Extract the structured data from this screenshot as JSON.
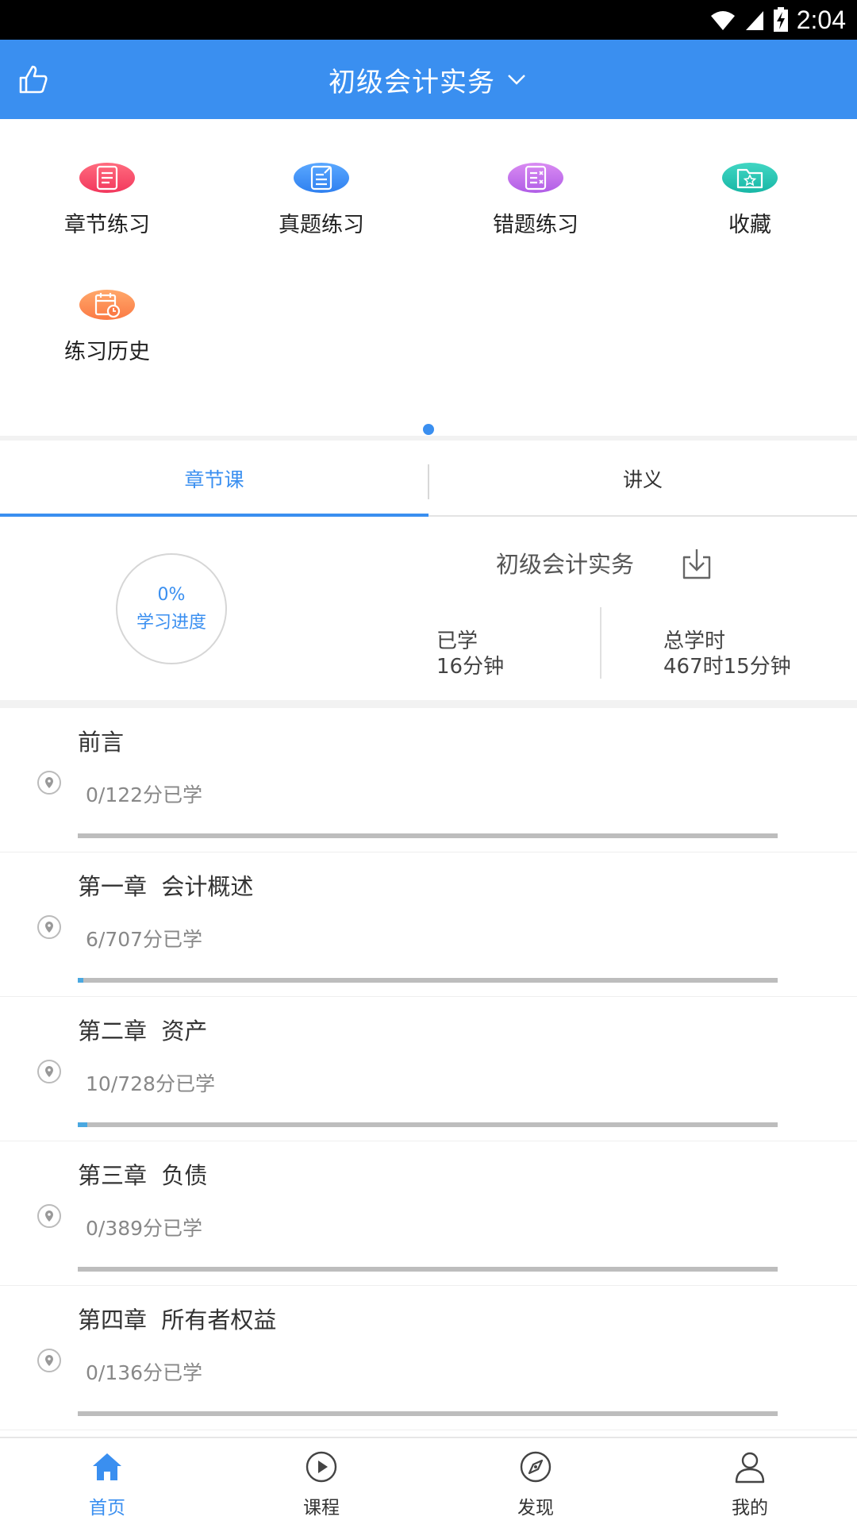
{
  "status_bar": {
    "time": "2:04"
  },
  "app_bar": {
    "title": "初级会计实务"
  },
  "quick_actions": [
    {
      "label": "章节练习",
      "icon": "chapter-practice-icon",
      "color_top": "#ff6b7e",
      "color_bottom": "#f2385d"
    },
    {
      "label": "真题练习",
      "icon": "exam-practice-icon",
      "color_top": "#5aa8ff",
      "color_bottom": "#2f80f0"
    },
    {
      "label": "错题练习",
      "icon": "wrong-question-icon",
      "color_top": "#d98bf2",
      "color_bottom": "#b05de6"
    },
    {
      "label": "收藏",
      "icon": "favorite-folder-icon",
      "color_top": "#41d6c3",
      "color_bottom": "#18b7a6"
    },
    {
      "label": "练习历史",
      "icon": "practice-history-icon",
      "color_top": "#ffa86b",
      "color_bottom": "#fb7a45"
    }
  ],
  "tabs": [
    {
      "label": "章节课",
      "active": true
    },
    {
      "label": "讲义",
      "active": false
    }
  ],
  "summary": {
    "progress_percent": "0%",
    "progress_label": "学习进度",
    "course_title": "初级会计实务",
    "learned_label": "已学",
    "learned_value": "16分钟",
    "total_label": "总学时",
    "total_value": "467时15分钟"
  },
  "chapters": [
    {
      "title": "前言",
      "progress_text": "0/122分已学",
      "fraction": 0.0
    },
    {
      "title": "第一章  会计概述",
      "progress_text": "6/707分已学",
      "fraction": 0.0085
    },
    {
      "title": "第二章  资产",
      "progress_text": "10/728分已学",
      "fraction": 0.0137
    },
    {
      "title": "第三章  负债",
      "progress_text": "0/389分已学",
      "fraction": 0.0
    },
    {
      "title": "第四章  所有者权益",
      "progress_text": "0/136分已学",
      "fraction": 0.0
    }
  ],
  "bottom_nav": [
    {
      "label": "首页",
      "icon": "home-icon",
      "active": true
    },
    {
      "label": "课程",
      "icon": "play-circle-icon",
      "active": false
    },
    {
      "label": "发现",
      "icon": "compass-icon",
      "active": false
    },
    {
      "label": "我的",
      "icon": "person-icon",
      "active": false
    }
  ],
  "colors": {
    "accent": "#3a8ff0",
    "progress_fill": "#4aa8e0",
    "progress_track": "#bdbdbd"
  }
}
